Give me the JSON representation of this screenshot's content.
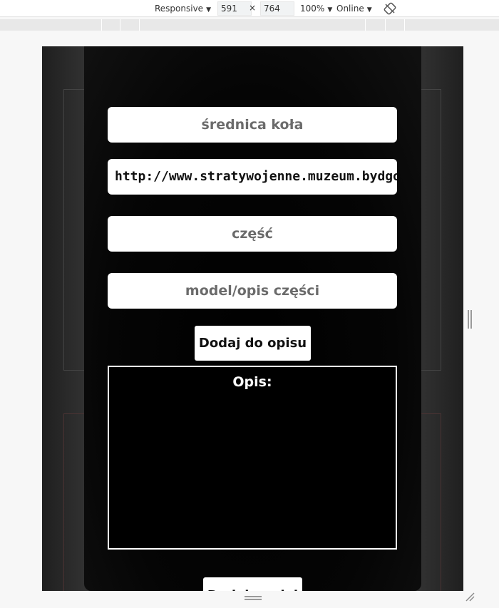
{
  "devtools": {
    "device_mode": "Responsive",
    "width": "591",
    "times": "×",
    "height": "764",
    "zoom": "100%",
    "network": "Online",
    "icons": {
      "rotate": "rotate-icon",
      "caret": "caret-down-icon"
    }
  },
  "form": {
    "wheel_diameter_placeholder": "średnica koła",
    "url_value": "http://www.stratywojenne.muzeum.bydgoszcz.pl",
    "part_placeholder": "część",
    "part_model_placeholder": "model/opis części",
    "add_to_description_label": "Dodaj do opisu",
    "description_label": "Opis:",
    "add_model_label": "Dodaj model"
  },
  "colors": {
    "modal_bg": "#000000",
    "field_bg": "#ffffff",
    "placeholder_text": "#6b6b6b"
  }
}
